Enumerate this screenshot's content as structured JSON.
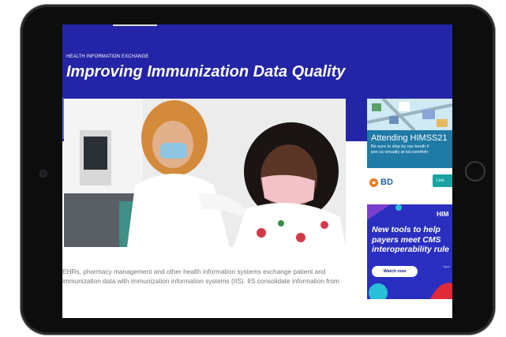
{
  "article": {
    "category": "HEALTH INFORMATION EXCHANGE",
    "title": "Improving Immunization Data Quality",
    "body": "EHRs, pharmacy management and other health information systems exchange patient and immunization data with immunization information systems (IIS). IIS consolidate information from"
  },
  "ad_himss": {
    "heading": "Attending HIMSS21",
    "line1": "Be sure to stop by our booth #",
    "line2": "join us virtually at bd.com/him",
    "logo_text": "BD",
    "button_label": "Lear"
  },
  "ad_interop": {
    "brand": "HIM",
    "headline": "New tools to help payers meet CMS interoperability rule",
    "button_label": "Watch now",
    "small_text": "Spon"
  },
  "colors": {
    "hero_blue": "#2424a6",
    "ad_teal": "#1f7aa6",
    "ad_blue": "#2a2fbf"
  }
}
